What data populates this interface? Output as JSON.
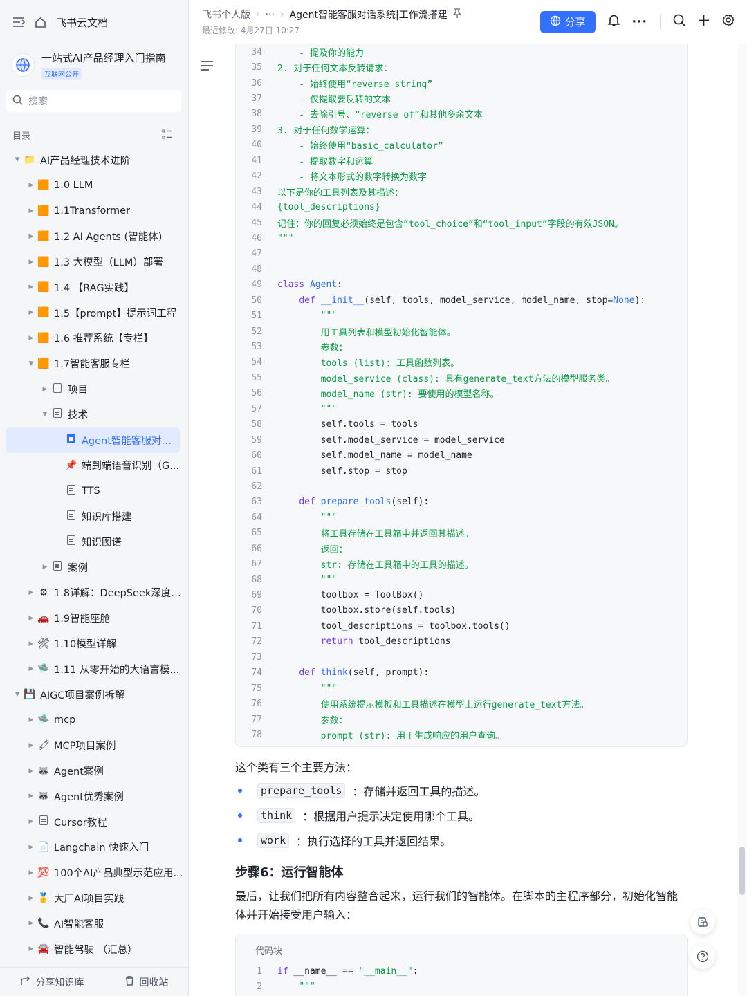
{
  "topbar": {
    "app_name": "飞书云文档"
  },
  "knowledge_base": {
    "title": "一站式AI产品经理入门指南",
    "badge": "互联网公开"
  },
  "search": {
    "placeholder": "搜索"
  },
  "toc": {
    "label": "目录"
  },
  "tree": [
    {
      "level": 0,
      "arrow": "▼",
      "icon": "📁",
      "label": "AI产品经理技术进阶"
    },
    {
      "level": 1,
      "arrow": "▶",
      "icon": "🟧",
      "label": "1.0 LLM"
    },
    {
      "level": 1,
      "arrow": "▶",
      "icon": "🟧",
      "label": "1.1Transformer"
    },
    {
      "level": 1,
      "arrow": "▶",
      "icon": "🟧",
      "label": "1.2 AI Agents (智能体)"
    },
    {
      "level": 1,
      "arrow": "▶",
      "icon": "🟧",
      "label": "1.3 大模型（LLM）部署"
    },
    {
      "level": 1,
      "arrow": "▶",
      "icon": "🟧",
      "label": "1.4 【RAG实践】"
    },
    {
      "level": 1,
      "arrow": "▶",
      "icon": "🟧",
      "label": "1.5【prompt】提示词工程"
    },
    {
      "level": 1,
      "arrow": "▶",
      "icon": "🟧",
      "label": "1.6 推荐系统【专栏】"
    },
    {
      "level": 1,
      "arrow": "▼",
      "icon": "🟧",
      "label": "1.7智能客服专栏"
    },
    {
      "level": 2,
      "arrow": "▶",
      "icon": "doc",
      "label": "项目"
    },
    {
      "level": 2,
      "arrow": "▼",
      "icon": "doc",
      "label": "技术"
    },
    {
      "level": 3,
      "arrow": "",
      "icon": "doc-blue",
      "label": "Agent智能客服对话...",
      "active": true
    },
    {
      "level": 3,
      "arrow": "",
      "icon": "📌",
      "label": "端到端语音识别（G..."
    },
    {
      "level": 3,
      "arrow": "",
      "icon": "doc",
      "label": "TTS"
    },
    {
      "level": 3,
      "arrow": "",
      "icon": "doc",
      "label": "知识库搭建"
    },
    {
      "level": 3,
      "arrow": "",
      "icon": "doc",
      "label": "知识图谱"
    },
    {
      "level": 2,
      "arrow": "▶",
      "icon": "doc",
      "label": "案例"
    },
    {
      "level": 1,
      "arrow": "▶",
      "icon": "⚙",
      "label": "1.8详解：DeepSeek深度推..."
    },
    {
      "level": 1,
      "arrow": "▶",
      "icon": "🚗",
      "label": "1.9智能座舱"
    },
    {
      "level": 1,
      "arrow": "▶",
      "icon": "🛠",
      "label": "1.10模型详解"
    },
    {
      "level": 1,
      "arrow": "▶",
      "icon": "🛸",
      "label": "1.11 从零开始的大语言模..."
    },
    {
      "level": 0,
      "arrow": "▼",
      "icon": "💾",
      "label": "AIGC项目案例拆解"
    },
    {
      "level": 1,
      "arrow": "▶",
      "icon": "🛸",
      "label": "mcp"
    },
    {
      "level": 1,
      "arrow": "▶",
      "icon": "🖍",
      "label": "MCP项目案例"
    },
    {
      "level": 1,
      "arrow": "▶",
      "icon": "🦝",
      "label": "Agent案例"
    },
    {
      "level": 1,
      "arrow": "▶",
      "icon": "🦝",
      "label": "Agent优秀案例"
    },
    {
      "level": 1,
      "arrow": "▶",
      "icon": "doc",
      "label": "Cursor教程"
    },
    {
      "level": 1,
      "arrow": "▶",
      "icon": "📄",
      "label": "Langchain 快速入门"
    },
    {
      "level": 1,
      "arrow": "▶",
      "icon": "💯",
      "label": "100个AI产品典型示范应用..."
    },
    {
      "level": 1,
      "arrow": "▶",
      "icon": "🥇",
      "label": "大厂AI项目实践"
    },
    {
      "level": 1,
      "arrow": "▶",
      "icon": "📞",
      "label": "AI智能客服"
    },
    {
      "level": 1,
      "arrow": "▶",
      "icon": "🚘",
      "label": "智能驾驶 （汇总）"
    }
  ],
  "sidebar_bottom": {
    "share": "分享知识库",
    "trash": "回收站"
  },
  "header": {
    "breadcrumb": [
      "飞书个人版",
      "···",
      "Agent智能客服对话系统|工作流搭建"
    ],
    "modified": "最近修改: 4月27日 10:27",
    "share": "分享"
  },
  "code1": [
    {
      "n": "34",
      "t": "    - 提及你的能力",
      "c": "c"
    },
    {
      "n": "35",
      "t": "2. 对于任何文本反转请求：",
      "c": "c"
    },
    {
      "n": "36",
      "t": "    - 始终使用“reverse_string”",
      "c": "c"
    },
    {
      "n": "37",
      "t": "    - 仅提取要反转的文本",
      "c": "c"
    },
    {
      "n": "38",
      "t": "    - 去除引号、“reverse of”和其他多余文本",
      "c": "c"
    },
    {
      "n": "39",
      "t": "3. 对于任何数学运算：",
      "c": "c"
    },
    {
      "n": "40",
      "t": "    - 始终使用“basic_calculator”",
      "c": "c"
    },
    {
      "n": "41",
      "t": "    - 提取数字和运算",
      "c": "c"
    },
    {
      "n": "42",
      "t": "    - 将文本形式的数字转换为数字",
      "c": "c"
    },
    {
      "n": "43",
      "t": "以下是你的工具列表及其描述：",
      "c": "c"
    },
    {
      "n": "44",
      "t": "{tool_descriptions}",
      "c": "c"
    },
    {
      "n": "45",
      "t": "记住：你的回复必须始终是包含“tool_choice”和“tool_input”字段的有效JSON。",
      "c": "c"
    },
    {
      "n": "46",
      "t": "\"\"\"",
      "c": "c"
    },
    {
      "n": "47",
      "t": "",
      "c": ""
    },
    {
      "n": "48",
      "t": "",
      "c": ""
    },
    {
      "n": "49",
      "t": "class Agent:",
      "c": "cls"
    },
    {
      "n": "50",
      "t": "    def __init__(self, tools, model_service, model_name, stop=None):",
      "c": "init"
    },
    {
      "n": "51",
      "t": "        \"\"\"",
      "c": "c"
    },
    {
      "n": "52",
      "t": "        用工具列表和模型初始化智能体。",
      "c": "c"
    },
    {
      "n": "53",
      "t": "        参数：",
      "c": "c"
    },
    {
      "n": "54",
      "t": "        tools (list): 工具函数列表。",
      "c": "c"
    },
    {
      "n": "55",
      "t": "        model_service (class): 具有generate_text方法的模型服务类。",
      "c": "c"
    },
    {
      "n": "56",
      "t": "        model_name (str): 要使用的模型名称。",
      "c": "c"
    },
    {
      "n": "57",
      "t": "        \"\"\"",
      "c": "c"
    },
    {
      "n": "58",
      "t": "        self.tools = tools",
      "c": ""
    },
    {
      "n": "59",
      "t": "        self.model_service = model_service",
      "c": ""
    },
    {
      "n": "60",
      "t": "        self.model_name = model_name",
      "c": ""
    },
    {
      "n": "61",
      "t": "        self.stop = stop",
      "c": ""
    },
    {
      "n": "62",
      "t": "",
      "c": ""
    },
    {
      "n": "63",
      "t": "    def prepare_tools(self):",
      "c": "def"
    },
    {
      "n": "64",
      "t": "        \"\"\"",
      "c": "c"
    },
    {
      "n": "65",
      "t": "        将工具存储在工具箱中并返回其描述。",
      "c": "c"
    },
    {
      "n": "66",
      "t": "        返回：",
      "c": "c"
    },
    {
      "n": "67",
      "t": "        str: 存储在工具箱中的工具的描述。",
      "c": "c"
    },
    {
      "n": "68",
      "t": "        \"\"\"",
      "c": "c"
    },
    {
      "n": "69",
      "t": "        toolbox = ToolBox()",
      "c": ""
    },
    {
      "n": "70",
      "t": "        toolbox.store(self.tools)",
      "c": ""
    },
    {
      "n": "71",
      "t": "        tool_descriptions = toolbox.tools()",
      "c": ""
    },
    {
      "n": "72",
      "t": "        return tool_descriptions",
      "c": "ret"
    },
    {
      "n": "73",
      "t": "",
      "c": ""
    },
    {
      "n": "74",
      "t": "    def think(self, prompt):",
      "c": "def"
    },
    {
      "n": "75",
      "t": "        \"\"\"",
      "c": "c"
    },
    {
      "n": "76",
      "t": "        使用系统提示模板和工具描述在模型上运行generate_text方法。",
      "c": "c"
    },
    {
      "n": "77",
      "t": "        参数：",
      "c": "c"
    },
    {
      "n": "78",
      "t": "        prompt (str): 用于生成响应的用户查询。",
      "c": "c"
    }
  ],
  "body": {
    "intro": "这个类有三个主要方法：",
    "bullets": [
      {
        "code": "prepare_tools",
        "text": "：存储并返回工具的描述。"
      },
      {
        "code": "think",
        "text": "：根据用户提示决定使用哪个工具。"
      },
      {
        "code": "work",
        "text": "：执行选择的工具并返回结果。"
      }
    ],
    "step_heading": "步骤6：运行智能体",
    "step_para": "最后，让我们把所有内容整合起来，运行我们的智能体。在脚本的主程序部分，初始化智能体并开始接受用户输入：",
    "code2_caption": "代码块",
    "code2": [
      {
        "n": "1",
        "t": "if __name__ == \"__main__\":"
      },
      {
        "n": "2",
        "t": "    \"\"\""
      }
    ]
  },
  "colors": {
    "accent": "#3370ff",
    "comment": "#0a9e45",
    "keyword": "#7c3aed"
  },
  "icons": [
    "sidebar-toggle-icon",
    "home-icon",
    "search-icon",
    "outline-icon",
    "globe-icon",
    "bell-icon",
    "more-icon",
    "plus-icon",
    "settings-icon",
    "pin-icon",
    "share-icon",
    "trash-icon",
    "help-icon"
  ]
}
